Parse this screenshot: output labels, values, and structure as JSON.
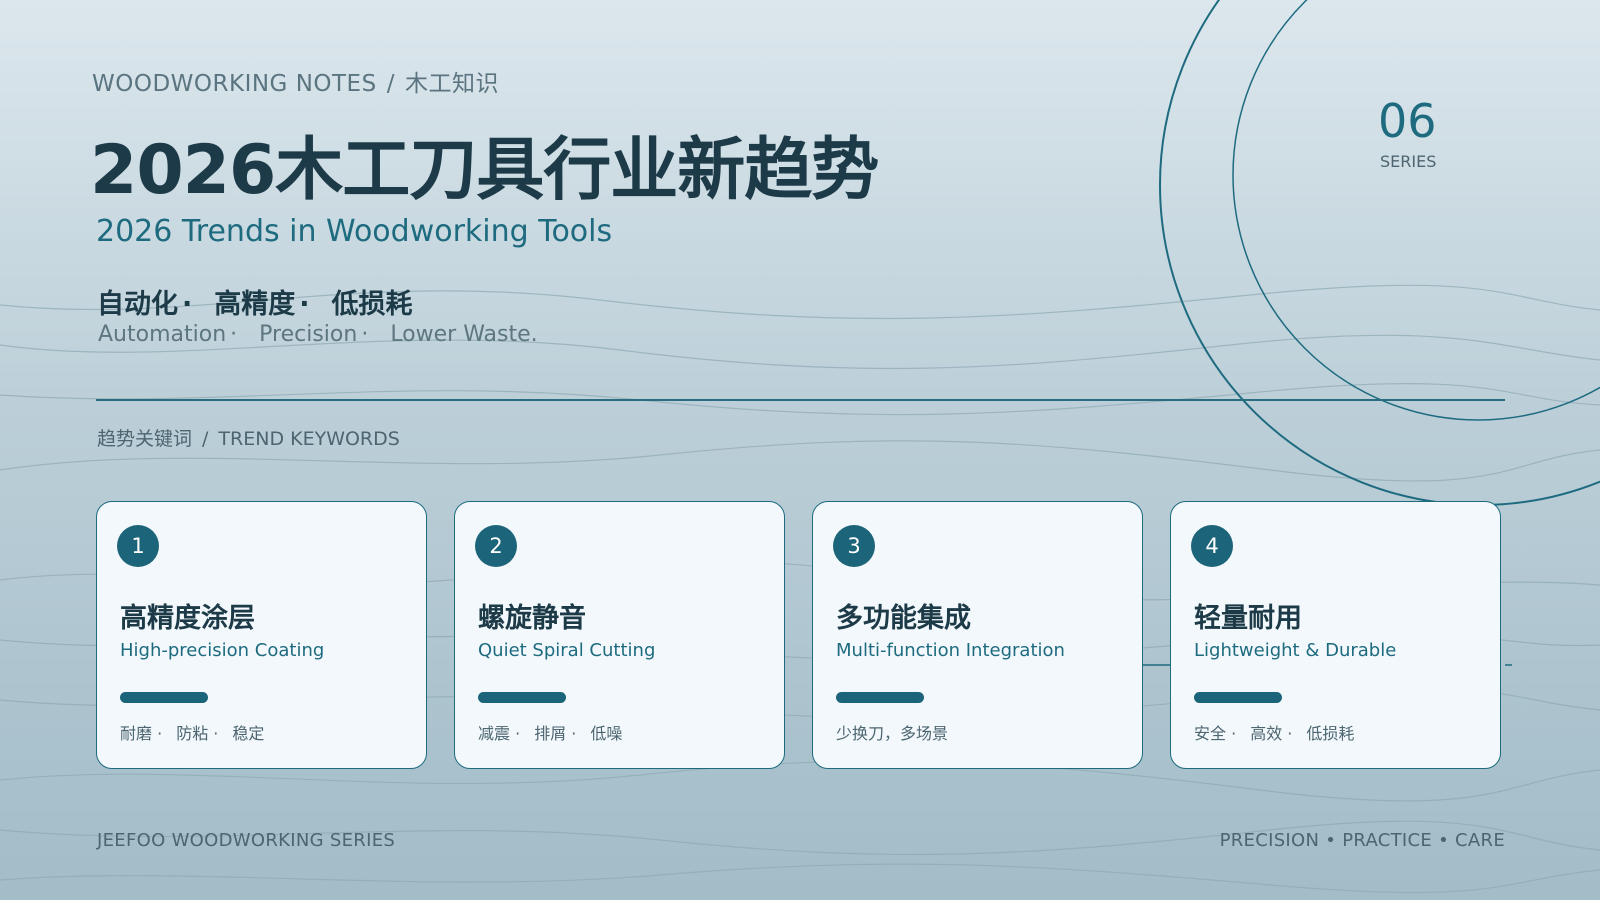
{
  "header": {
    "eyebrow_en": "WOODWORKING NOTES",
    "eyebrow_sep": "/",
    "eyebrow_cn": "木工知识",
    "title": "2026木工刀具行业新趋势",
    "subtitle": "2026 Trends in Woodworking Tools"
  },
  "series": {
    "number": "06",
    "label": "SERIES"
  },
  "keywords": {
    "cn": [
      "自动化",
      "高精度",
      "低损耗"
    ],
    "en": [
      "Automation",
      "Precision",
      "Lower Waste."
    ],
    "separator": "·"
  },
  "section": {
    "cn": "趋势关键词",
    "sep": "/",
    "en": "TREND KEYWORDS"
  },
  "cards": [
    {
      "num": "1",
      "cn": "高精度涂层",
      "en": "High-precision Coating",
      "tags": [
        "耐磨 ·",
        "防粘 ·",
        "稳定"
      ]
    },
    {
      "num": "2",
      "cn": "螺旋静音",
      "en": "Quiet Spiral Cutting",
      "tags": [
        "减震 ·",
        "排屑 ·",
        "低噪"
      ]
    },
    {
      "num": "3",
      "cn": "多功能集成",
      "en": "Multi-function Integration",
      "tags": [
        "少换刀，多场景"
      ]
    },
    {
      "num": "4",
      "cn": "轻量耐用",
      "en": "Lightweight & Durable",
      "tags": [
        "安全 ·",
        "高效 ·",
        "低损耗"
      ]
    }
  ],
  "footer": {
    "left": "JEEFOO WOODWORKING SERIES",
    "right": "PRECISION • PRACTICE • CARE"
  },
  "colors": {
    "accent": "#1e6b80",
    "dark": "#1d3a48",
    "card_bg": "#f2f8fb"
  }
}
